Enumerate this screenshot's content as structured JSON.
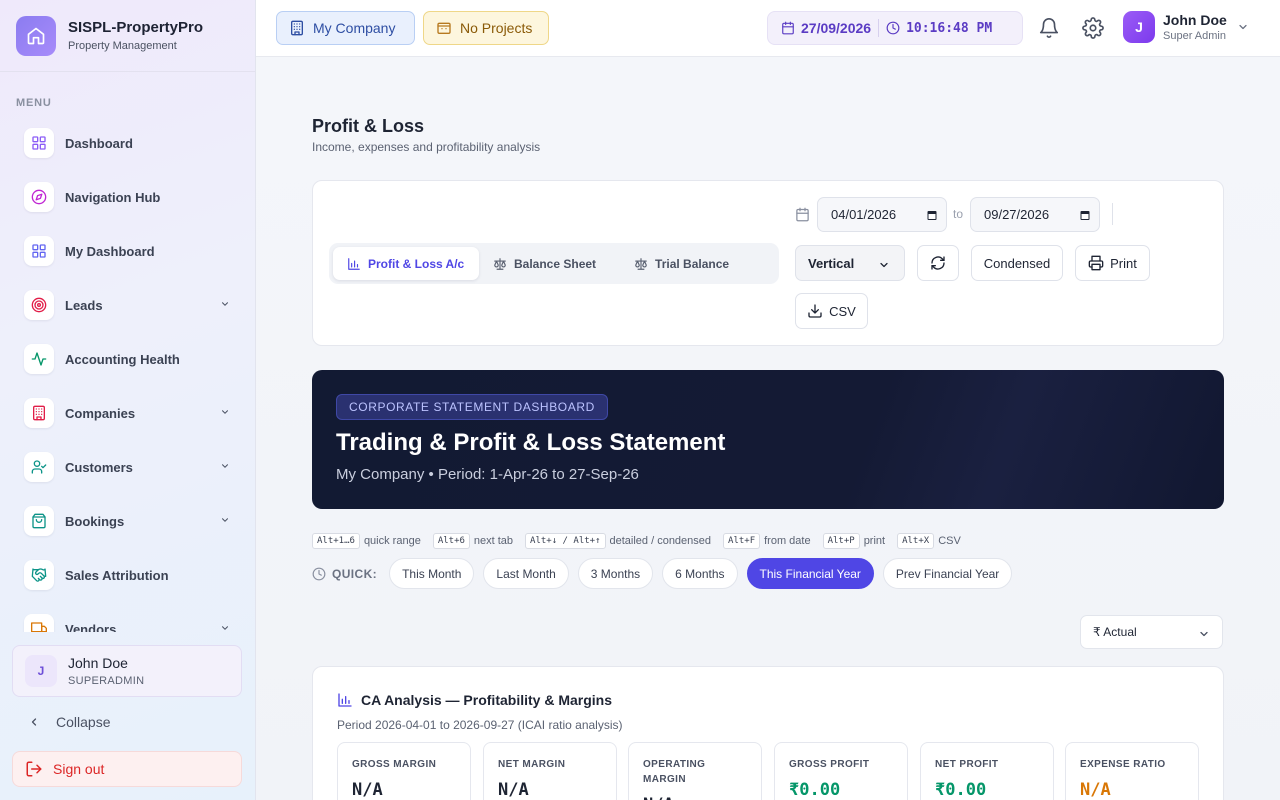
{
  "brand": {
    "name": "SISPL-PropertyPro",
    "subtitle": "Property Management"
  },
  "sidebar": {
    "menu_label": "MENU",
    "items": [
      {
        "label": "Dashboard",
        "icon": "grid-icon",
        "color": "#8b5cf6",
        "expandable": false
      },
      {
        "label": "Navigation Hub",
        "icon": "compass-icon",
        "color": "#c026d3",
        "expandable": false
      },
      {
        "label": "My Dashboard",
        "icon": "grid-icon",
        "color": "#6366f1",
        "expandable": false
      },
      {
        "label": "Leads",
        "icon": "target-icon",
        "color": "#e11d48",
        "expandable": true
      },
      {
        "label": "Accounting Health",
        "icon": "activity-icon",
        "color": "#059669",
        "expandable": false
      },
      {
        "label": "Companies",
        "icon": "building-icon",
        "color": "#e11d48",
        "expandable": true
      },
      {
        "label": "Customers",
        "icon": "user-check-icon",
        "color": "#0d9488",
        "expandable": true
      },
      {
        "label": "Bookings",
        "icon": "bag-icon",
        "color": "#0d9488",
        "expandable": true
      },
      {
        "label": "Sales Attribution",
        "icon": "handshake-icon",
        "color": "#0d9488",
        "expandable": false
      },
      {
        "label": "Vendors",
        "icon": "truck-icon",
        "color": "#d97706",
        "expandable": true
      }
    ],
    "user": {
      "initial": "J",
      "name": "John Doe",
      "role": "SUPERADMIN"
    },
    "collapse_label": "Collapse",
    "signout_label": "Sign out"
  },
  "topbar": {
    "company_label": "My Company",
    "projects_label": "No Projects",
    "date": "27/09/2026",
    "time": "10:16:48 PM",
    "user": {
      "initial": "J",
      "name": "John Doe",
      "role": "Super Admin"
    }
  },
  "page": {
    "title": "Profit & Loss",
    "subtitle": "Income, expenses and profitability analysis"
  },
  "filters": {
    "tabs": [
      {
        "label": "Profit & Loss A/c",
        "active": true
      },
      {
        "label": "Balance Sheet",
        "active": false
      },
      {
        "label": "Trial Balance",
        "active": false
      }
    ],
    "date_from": "04/01/2026",
    "to_label": "to",
    "date_to": "09/27/2026",
    "layout_select": "Vertical",
    "condensed_label": "Condensed",
    "print_label": "Print",
    "csv_label": "CSV"
  },
  "hero": {
    "badge": "CORPORATE STATEMENT DASHBOARD",
    "title": "Trading & Profit & Loss Statement",
    "subtitle": "My Company • Period: 1-Apr-26 to 27-Sep-26"
  },
  "shortcuts": [
    {
      "key": "Alt+1…6",
      "label": "quick range"
    },
    {
      "key": "Alt+6",
      "label": "next tab"
    },
    {
      "key": "Alt+↓ / Alt+↑",
      "label": "detailed / condensed"
    },
    {
      "key": "Alt+F",
      "label": "from date"
    },
    {
      "key": "Alt+P",
      "label": "print"
    },
    {
      "key": "Alt+X",
      "label": "CSV"
    }
  ],
  "quick": {
    "label": "QUICK:",
    "ranges": [
      {
        "label": "This Month",
        "active": false
      },
      {
        "label": "Last Month",
        "active": false
      },
      {
        "label": "3 Months",
        "active": false
      },
      {
        "label": "6 Months",
        "active": false
      },
      {
        "label": "This Financial Year",
        "active": true
      },
      {
        "label": "Prev Financial Year",
        "active": false
      }
    ]
  },
  "currency_select": "₹ Actual",
  "ca": {
    "title": "CA Analysis — Profitability & Margins",
    "subtitle": "Period 2026-04-01 to 2026-09-27 (ICAI ratio analysis)",
    "metrics": [
      {
        "label": "GROSS MARGIN",
        "value": "N/A",
        "color": "#1e2433"
      },
      {
        "label": "NET MARGIN",
        "value": "N/A",
        "color": "#1e2433"
      },
      {
        "label": "OPERATING MARGIN",
        "value": "N/A",
        "color": "#1e2433"
      },
      {
        "label": "GROSS PROFIT",
        "value": "₹0.00",
        "color": "#059669"
      },
      {
        "label": "NET PROFIT",
        "value": "₹0.00",
        "color": "#059669"
      },
      {
        "label": "EXPENSE RATIO",
        "value": "N/A",
        "color": "#d97706"
      }
    ]
  }
}
